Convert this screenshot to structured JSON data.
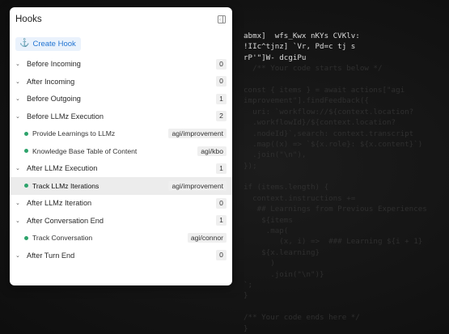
{
  "panel": {
    "title": "Hooks",
    "create_label": "Create Hook",
    "groups": [
      {
        "label": "Before Incoming",
        "count": "0",
        "items": []
      },
      {
        "label": "After Incoming",
        "count": "0",
        "items": []
      },
      {
        "label": "Before Outgoing",
        "count": "1",
        "items": []
      },
      {
        "label": "Before LLMz Execution",
        "count": "2",
        "items": [
          {
            "label": "Provide Learnings to LLMz",
            "tag": "agi/improvement"
          },
          {
            "label": "Knowledge Base Table of Content",
            "tag": "agi/kbo"
          }
        ]
      },
      {
        "label": "After LLMz Execution",
        "count": "1",
        "items": [
          {
            "label": "Track LLMz Iterations",
            "tag": "agi/improvement",
            "active": true
          }
        ]
      },
      {
        "label": "After LLMz Iteration",
        "count": "0",
        "items": []
      },
      {
        "label": "After Conversation End",
        "count": "1",
        "items": [
          {
            "label": "Track Conversation",
            "tag": "agi/connor"
          }
        ]
      },
      {
        "label": "After Turn End",
        "count": "0",
        "items": []
      }
    ]
  },
  "code": {
    "lines": [
      {
        "text": "abmx]  wfs_Kwx nKYs CVKlv:",
        "bright": true
      },
      {
        "text": "!IIc^tjnz] `Vr, Pd=c tj s",
        "bright": true
      },
      {
        "text": "rP'\"]W- dcgiPu",
        "bright": true
      },
      {
        "text": "  /** Your code starts below */",
        "bright": false
      },
      {
        "text": "",
        "bright": false
      },
      {
        "text": "const { items } = await actions[\"agi",
        "bright": false
      },
      {
        "text": "improvement\"].findFeedback({",
        "bright": false
      },
      {
        "text": "  uri: `workflow://${context.location?",
        "bright": false
      },
      {
        "text": "  .workflowId}/${context.location?",
        "bright": false
      },
      {
        "text": "  .nodeId}`,search: context.transcript",
        "bright": false
      },
      {
        "text": "  .map((x) => `${x.role}: ${x.content}`)",
        "bright": false
      },
      {
        "text": "  .join(\"\\n\"),",
        "bright": false
      },
      {
        "text": "});",
        "bright": false
      },
      {
        "text": "",
        "bright": false
      },
      {
        "text": "if (items.length) {",
        "bright": false
      },
      {
        "text": "  context.instructions +=",
        "bright": false
      },
      {
        "text": "   ## Learnings from Previous Experiences",
        "bright": false
      },
      {
        "text": "    ${items",
        "bright": false
      },
      {
        "text": "     .map(",
        "bright": false
      },
      {
        "text": "        (x, i) =>  ### Learning ${i + 1}",
        "bright": false
      },
      {
        "text": "    ${x.learning}",
        "bright": false
      },
      {
        "text": "      )",
        "bright": false
      },
      {
        "text": "      .join(\"\\n\")}",
        "bright": false
      },
      {
        "text": "`;",
        "bright": false
      },
      {
        "text": "}",
        "bright": false
      },
      {
        "text": "",
        "bright": false
      },
      {
        "text": "/** Your code ends here */",
        "bright": false
      },
      {
        "text": "}",
        "bright": false
      }
    ]
  }
}
